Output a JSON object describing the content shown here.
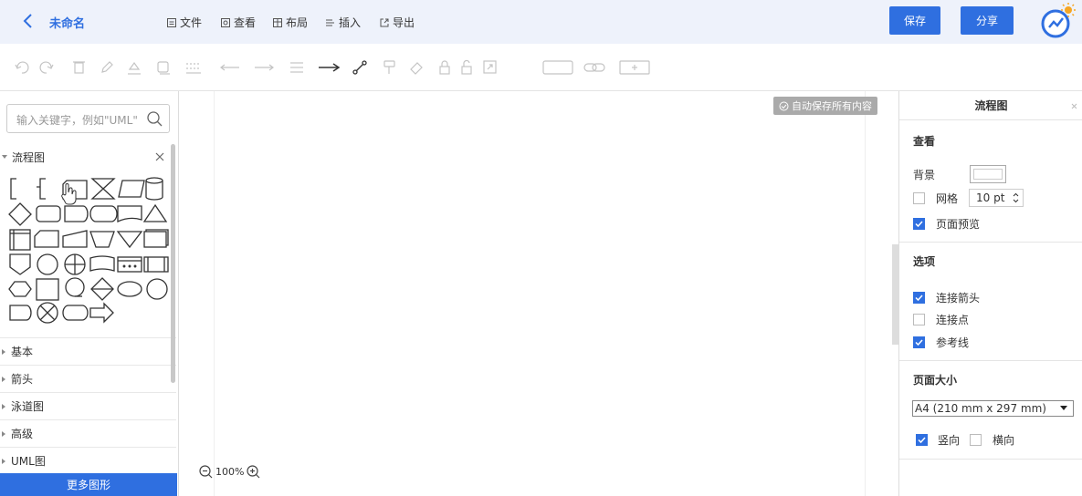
{
  "header": {
    "title": "未命名",
    "menus": [
      "文件",
      "查看",
      "布局",
      "插入",
      "导出"
    ],
    "save": "保存",
    "share": "分享"
  },
  "sidebar": {
    "search_placeholder": "输入关键字，例如\"UML\"",
    "flow_section": "流程图",
    "sections": [
      "基本",
      "箭头",
      "泳道图",
      "高级",
      "UML图"
    ],
    "more": "更多图形"
  },
  "canvas": {
    "autosave": "自动保存所有内容",
    "zoom": "100%"
  },
  "panel": {
    "title": "流程图",
    "view": "查看",
    "background": "背景",
    "grid": "网格",
    "grid_size": "10 pt",
    "page_preview": "页面预览",
    "options": "选项",
    "connect_arrows": "连接箭头",
    "connect_points": "连接点",
    "guides": "参考线",
    "page_size": "页面大小",
    "page_size_value": "A4 (210 mm x 297 mm)",
    "portrait": "竖向",
    "landscape": "横向"
  },
  "state": {
    "grid_checked": false,
    "page_preview_checked": true,
    "connect_arrows_checked": true,
    "connect_points_checked": false,
    "guides_checked": true,
    "portrait_checked": true,
    "landscape_checked": false
  },
  "colors": {
    "accent": "#2f6fe0",
    "topbar": "#eef2fb"
  }
}
